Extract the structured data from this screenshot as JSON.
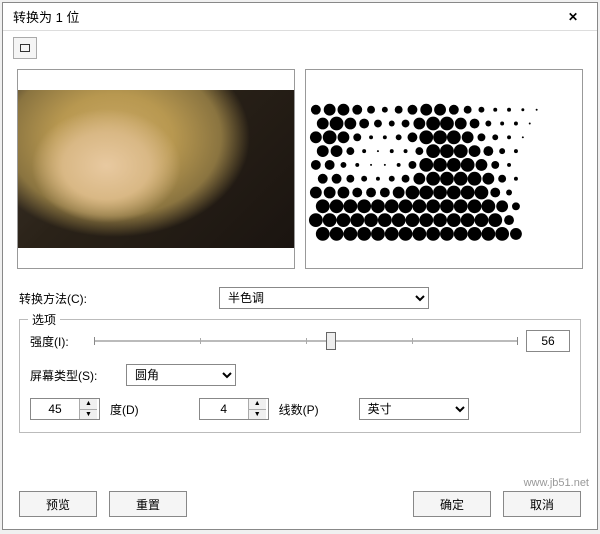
{
  "dialog": {
    "title": "转换为 1 位",
    "close_icon": "close"
  },
  "toolbar": {
    "preview_mode_tooltip": "预览模式"
  },
  "method": {
    "label": "转换方法(C):",
    "value": "半色调"
  },
  "options": {
    "legend": "选项",
    "intensity_label": "强度(I):",
    "intensity_value": "56",
    "intensity_min": 0,
    "intensity_max": 100,
    "screen_type_label": "屏幕类型(S):",
    "screen_type_value": "圆角",
    "angle_value": "45",
    "angle_label": "度(D)",
    "lines_value": "4",
    "lines_label": "线数(P)",
    "unit_value": "英寸"
  },
  "buttons": {
    "preview": "预览",
    "reset": "重置",
    "ok": "确定",
    "cancel": "取消"
  },
  "watermark": "www.jb51.net"
}
